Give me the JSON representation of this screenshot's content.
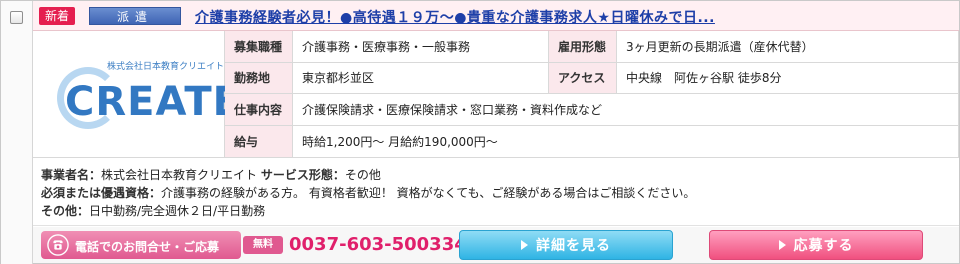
{
  "header": {
    "new_badge": "新着",
    "type_badge": "派遣",
    "title": "介護事務経験者必見！●高待遇１９万～●貴重な介護事務求人★日曜休みで日..."
  },
  "logo": {
    "company_small": "株式会社日本教育クリエイト",
    "word": "CREATE"
  },
  "info": {
    "job_type_label": "募集職種",
    "job_type_value": "介護事務・医療事務・一般事務",
    "employment_label": "雇用形態",
    "employment_value": "3ヶ月更新の長期派遣（産休代替）",
    "location_label": "勤務地",
    "location_value": "東京都杉並区",
    "access_label": "アクセス",
    "access_value": "中央線　阿佐ヶ谷駅 徒歩8分",
    "duties_label": "仕事内容",
    "duties_value": "介護保険請求・医療保険請求・窓口業務・資料作成など",
    "salary_label": "給与",
    "salary_value": "時給1,200円～ 月給約190,000円～"
  },
  "details": {
    "company_label": "事業者名：",
    "company_value": "株式会社日本教育クリエイト",
    "service_label": "サービス形態：",
    "service_value": "その他",
    "required_label": "必須または優遇資格：",
    "required_value": "介護事務の経験がある方。 有資格者歓迎！ 資格がなくても、ご経験がある場合はご相談ください。",
    "other_label": "その他：",
    "other_value": "日中勤務/完全週休２日/平日勤務"
  },
  "footer": {
    "phone_label": "電話でのお問合せ・ご応募",
    "free_label": "無料",
    "phone_number": "0037-603-500334",
    "detail_button": "詳細を見る",
    "apply_button": "応募する"
  },
  "colors": {
    "accent_pink": "#e05990",
    "title_blue": "#1e3fa8",
    "detail_button": "#2fb4e4",
    "apply_button": "#f0507f"
  },
  "icons": {
    "phone": "phone-icon",
    "arrow": "arrow-right-icon"
  }
}
